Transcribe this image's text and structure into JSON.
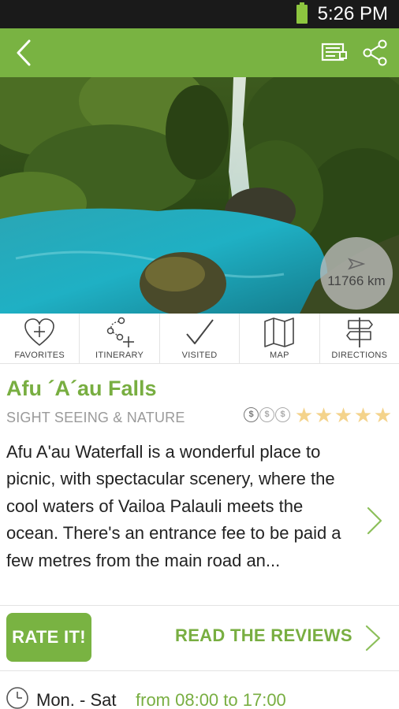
{
  "status_bar": {
    "time": "5:26 PM",
    "battery_color": "#8dc63f"
  },
  "app_bar": {
    "color": "#79b342",
    "back_icon": "chevron-left-icon",
    "document_icon": "document-icon",
    "share_icon": "share-icon"
  },
  "hero": {
    "image": "waterfall-lagoon-photo",
    "distance": "11766 km",
    "distance_icon": "navigation-arrow-icon"
  },
  "actions": [
    {
      "label": "FAVORITES",
      "icon": "heart-plus-icon"
    },
    {
      "label": "ITINERARY",
      "icon": "route-plus-icon"
    },
    {
      "label": "VISITED",
      "icon": "checkmark-icon"
    },
    {
      "label": "MAP",
      "icon": "map-icon"
    },
    {
      "label": "DIRECTIONS",
      "icon": "signpost-icon"
    }
  ],
  "place": {
    "title": "Afu ´A´au Falls",
    "category": "SIGHT SEEING & NATURE",
    "price_symbols": [
      "$",
      "$",
      "$"
    ],
    "price_level": 1,
    "rating": 5,
    "rating_max": 5,
    "description": "Afu A'au Waterfall is a wonderful place to picnic, with spectacular scenery, where the cool waters of Vailoa Palauli meets the ocean. There's an entrance fee to be paid a few metres from the main road an..."
  },
  "rating_row": {
    "rate_button": "RATE IT!",
    "reviews_link": "READ THE REVIEWS"
  },
  "hours": {
    "days": "Mon. - Sat",
    "time": "from 08:00 to 17:00"
  },
  "colors": {
    "accent": "#79b342",
    "accent_text": "#78ae41",
    "muted": "#9a9a9a",
    "star": "#f4d38b"
  }
}
